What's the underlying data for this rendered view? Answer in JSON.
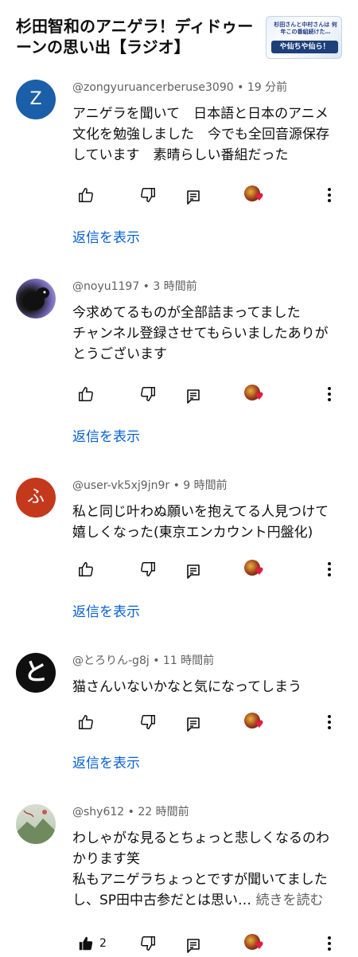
{
  "video": {
    "title": "杉田智和のアニゲラ！ディドゥーーンの思い出【ラジオ】",
    "thumb_caption": "杉田さんと中村さんは 何年この番組続けた…",
    "thumb_banner": "や仙ちや仙ら！"
  },
  "comments": [
    {
      "author": "@zongyuruancerberuse3090",
      "time": "19 分前",
      "avatar_letter": "Z",
      "avatar_color": "#1a5fa8",
      "lines": [
        "アニゲラを聞いて　日本語と日本のアニメ",
        "文化を勉強しました　今でも全回音源保存",
        "しています　素晴らしい番組だった"
      ],
      "replies_label": "返信を表示"
    },
    {
      "author": "@noyu1197",
      "time": "3 時間前",
      "avatar_letter": "",
      "avatar_color": "#3c3c52",
      "lines": [
        "今求めてるものが全部詰まってました",
        "チャンネル登録させてもらいましたありが",
        "とうございます"
      ],
      "replies_label": "返信を表示"
    },
    {
      "author": "@user-vk5xj9jn9r",
      "time": "9 時間前",
      "avatar_letter": "ふ",
      "avatar_color": "#c4381c",
      "lines": [
        "私と同じ叶わぬ願いを抱えてる人見つけて",
        "嬉しくなった(東京エンカウント円盤化)"
      ],
      "replies_label": "返信を表示"
    },
    {
      "author": "@とろりん-g8j",
      "time": "11 時間前",
      "avatar_letter": "と",
      "avatar_color": "#0f0f0f",
      "lines": [
        "猫さんいないかなと気になってしまう"
      ],
      "replies_label": "返信を表示"
    },
    {
      "author": "@shy612",
      "time": "22 時間前",
      "avatar_letter": "",
      "avatar_color": "#c9d3c1",
      "lines": [
        "わしゃがな見るとちょっと悲しくなるのわ",
        "かります笑",
        "私もアニゲラちょっとですが聞いてました",
        "し、SP田中古参だとは思い…"
      ],
      "read_more": "続きを読む",
      "like_count": "2"
    }
  ],
  "separator": " • "
}
